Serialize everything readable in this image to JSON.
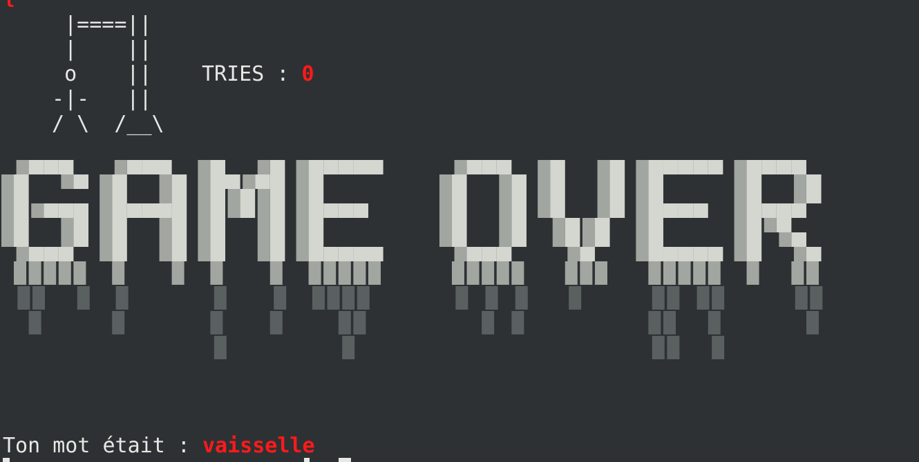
{
  "terminal": {
    "top_fragment": "{",
    "gallows_lines": [
      "  |====||",
      "  |    ||",
      "  o    ||",
      " -|-   ||",
      " / \\  /__\\"
    ],
    "tries_label": "TRIES : ",
    "tries_value": "0",
    "banner_text": "GAME OVER",
    "result_label": "Ton mot était : ",
    "result_word": "vaisselle"
  },
  "colors": {
    "background": "#2d3134",
    "foreground": "#e6e8e4",
    "accent_red": "#ff1a1a",
    "pixel_light": "#d4d7d0",
    "pixel_mid": "#a2a6a0",
    "pixel_dark": "#5a6060"
  }
}
